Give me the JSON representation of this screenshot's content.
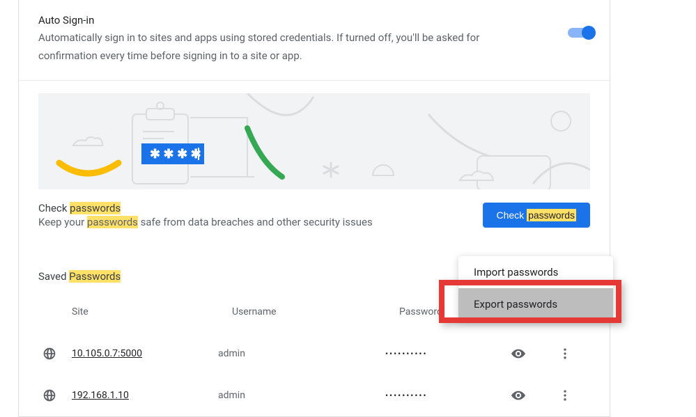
{
  "autoSignin": {
    "title": "Auto Sign-in",
    "description": "Automatically sign in to sites and apps using stored credentials. If turned off, you'll be asked for confirmation every time before signing in to a site or app."
  },
  "checkPasswords": {
    "titlePrefix": "Check ",
    "titleHighlight": "passwords",
    "descPrefix": "Keep your ",
    "descHighlight": "passwords",
    "descSuffix": " safe from data breaches and other security issues",
    "buttonPrefix": "Check ",
    "buttonHighlight": "passwords"
  },
  "saved": {
    "titlePrefix": "Saved ",
    "titleHighlight": "Passwords",
    "headers": {
      "site": "Site",
      "username": "Username",
      "password": "Password"
    },
    "rows": [
      {
        "site": "10.105.0.7:5000",
        "username": "admin",
        "password": "••••••••••"
      },
      {
        "site": "192.168.1.10",
        "username": "admin",
        "password": "••••••••••"
      }
    ]
  },
  "menu": {
    "import": "Import passwords",
    "export": "Export passwords"
  }
}
